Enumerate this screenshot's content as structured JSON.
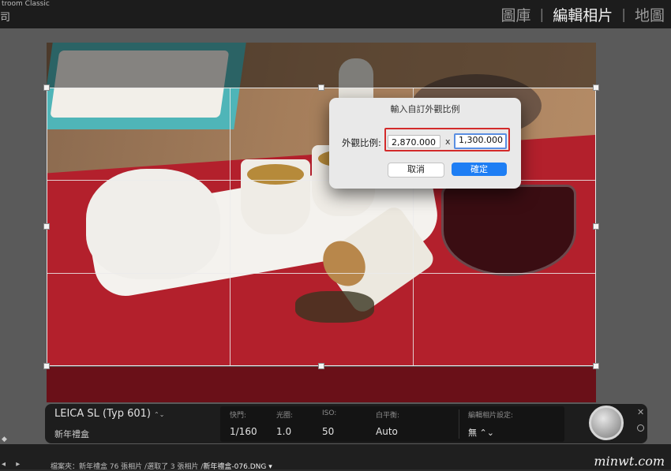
{
  "app": {
    "title": "troom Classic",
    "glyph": "司"
  },
  "modules": [
    {
      "label": "圖庫",
      "active": false
    },
    {
      "label": "編輯相片",
      "active": true
    },
    {
      "label": "地圖",
      "active": false
    }
  ],
  "dialog": {
    "title": "輸入自訂外觀比例",
    "label": "外觀比例:",
    "width_value": "2,870.000",
    "separator": "x",
    "height_value": "1,300.000",
    "cancel_label": "取消",
    "ok_label": "確定"
  },
  "info": {
    "camera": "LEICA SL (Typ 601)",
    "camera_chevron": "⌃⌄",
    "collection": "新年禮盒",
    "exif": [
      {
        "label": "快門:",
        "value": "1/160"
      },
      {
        "label": "光圈:",
        "value": "1.0"
      },
      {
        "label": "ISO:",
        "value": "50"
      },
      {
        "label": "白平衡:",
        "value": "Auto"
      }
    ],
    "preset_label": "編輯相片設定:",
    "preset_value": "無 ⌃⌄"
  },
  "bottom": {
    "nav": "◂ ▸",
    "path_prefix": "檔案夾：新年禮盒    76 張相片 /選取了 3 張相片 /",
    "filename": "新年禮盒-076.DNG ▾"
  },
  "watermark": "minwt.com",
  "colors": {
    "accent_blue": "#1e7ef4",
    "highlight_red": "#d32a2a"
  }
}
